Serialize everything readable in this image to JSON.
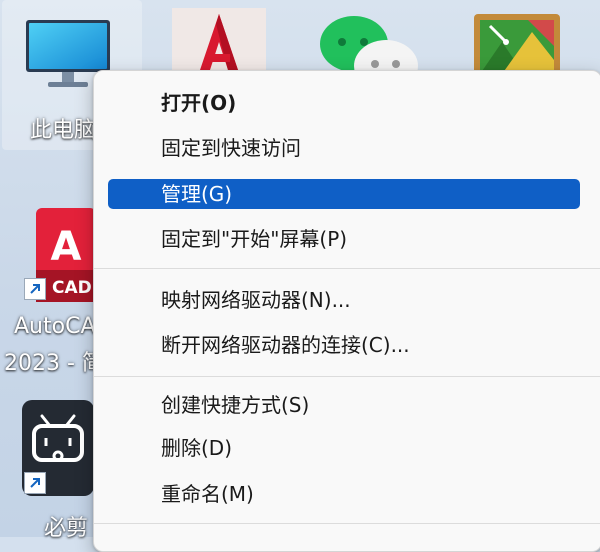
{
  "desktop": {
    "icons": [
      {
        "label": "此电脑",
        "icon": "monitor-icon"
      },
      {
        "label": "",
        "icon": "autocad-app-icon"
      },
      {
        "label": "",
        "icon": "wechat-icon"
      },
      {
        "label": "",
        "icon": "image-viewer-icon"
      },
      {
        "label_line1": "AutoCA",
        "label_line2": "2023 - 简",
        "badge": "CAD",
        "icon": "autocad-shortcut-icon"
      },
      {
        "label": "必剪",
        "icon": "bcut-icon"
      }
    ]
  },
  "context_menu": {
    "items": [
      {
        "label": "打开(O)",
        "bold": true
      },
      {
        "label": "固定到快速访问"
      },
      {
        "label": "管理(G)",
        "active": true
      },
      {
        "label": "固定到\"开始\"屏幕(P)"
      },
      {
        "label": "映射网络驱动器(N)..."
      },
      {
        "label": "断开网络驱动器的连接(C)..."
      },
      {
        "label": "创建快捷方式(S)"
      },
      {
        "label": "删除(D)"
      },
      {
        "label": "重命名(M)"
      }
    ]
  },
  "colors": {
    "highlight": "#0f5fc6",
    "menu_bg": "#f9f9f9",
    "desktop_bg": "#cdd9e8"
  }
}
